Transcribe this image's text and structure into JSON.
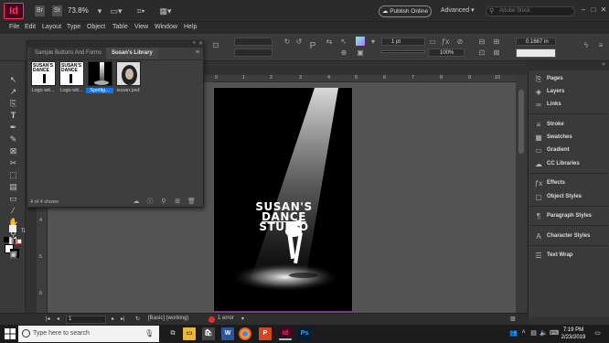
{
  "app": {
    "logo": "Id",
    "badges": [
      "Br",
      "St"
    ],
    "zoom": "73.8%",
    "publish_label": "Publish Online",
    "workspace_label": "Advanced",
    "search_placeholder": "Adobe Stock"
  },
  "menu": [
    "File",
    "Edit",
    "Layout",
    "Type",
    "Object",
    "Table",
    "View",
    "Window",
    "Help"
  ],
  "control": {
    "stroke_weight": "1 pt",
    "opacity": "100%",
    "size_value": "0.1667 in"
  },
  "ruler": {
    "h_ticks": [
      "0",
      "1",
      "2",
      "3",
      "4",
      "5",
      "6",
      "7",
      "8",
      "9",
      "10"
    ],
    "v_ticks": [
      "1",
      "2",
      "3",
      "4",
      "5",
      "6"
    ]
  },
  "library": {
    "tabs": [
      "Sample Buttons And Forms",
      "Susan's Library"
    ],
    "items": [
      {
        "label": "Logo wit...",
        "selected": false
      },
      {
        "label": "Logo wit...",
        "selected": false
      },
      {
        "label": "Spotlig...",
        "selected": true
      },
      {
        "label": "susan.psd",
        "selected": false
      }
    ],
    "count_text": "4 of 4 shown"
  },
  "page": {
    "logo_line1": "SUSAN'S",
    "logo_line2": "DANCE",
    "logo_line3": "STUDIO"
  },
  "panels": [
    {
      "label": "Pages",
      "icon": "pages-icon"
    },
    {
      "label": "Layers",
      "icon": "layers-icon"
    },
    {
      "label": "Links",
      "icon": "links-icon"
    },
    {
      "label": "Stroke",
      "icon": "stroke-icon"
    },
    {
      "label": "Swatches",
      "icon": "swatches-icon"
    },
    {
      "label": "Gradient",
      "icon": "gradient-icon"
    },
    {
      "label": "CC Libraries",
      "icon": "cc-libraries-icon"
    },
    {
      "label": "Effects",
      "icon": "effects-icon"
    },
    {
      "label": "Object Styles",
      "icon": "object-styles-icon"
    },
    {
      "label": "Paragraph Styles",
      "icon": "paragraph-styles-icon"
    },
    {
      "label": "Character Styles",
      "icon": "character-styles-icon"
    },
    {
      "label": "Text Wrap",
      "icon": "text-wrap-icon"
    }
  ],
  "status": {
    "page_number": "1",
    "preflight_profile": "[Basic] (working)",
    "error_text": "1 error"
  },
  "taskbar": {
    "search_placeholder": "Type here to search",
    "time": "7:19 PM",
    "date": "2/23/2019",
    "apps": [
      "task-view",
      "file-explorer",
      "store",
      "word",
      "chrome",
      "powerpoint",
      "indesign",
      "photoshop"
    ]
  },
  "colors": {
    "indesign_accent": "#ff3366",
    "error_red": "#e03030",
    "selection_blue": "#1473e6"
  }
}
